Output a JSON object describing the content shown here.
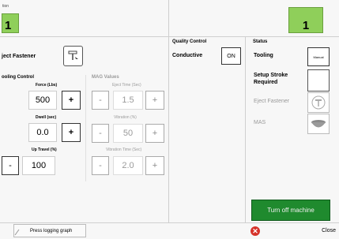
{
  "top": {
    "left_small_label": "tion",
    "left_counter": "1",
    "right_counter": "1"
  },
  "left": {
    "eject_label": "ject Fastener",
    "tooling_control_title": "ooling Control",
    "force_label": "Force (Lbs)",
    "force_value": "500",
    "dwell_label": "Dwell (sec)",
    "dwell_value": "0.0",
    "uptravel_label": "Up Travel (%)",
    "uptravel_value": "100",
    "plus": "+",
    "minus": "-"
  },
  "mag": {
    "title": "MAG Values",
    "eject_time_label": "Eject Time (Sec)",
    "eject_time_value": "1.5",
    "vibration_label": "Vibration (%)",
    "vibration_value": "50",
    "vibration_time_label": "Vibration Time (Sec)",
    "vibration_time_value": "2.0",
    "plus": "+",
    "minus": "-"
  },
  "quality": {
    "title": "Quality Control",
    "conductive_label": "Conductive",
    "conductive_state": "ON"
  },
  "status": {
    "title": "Status",
    "tooling_label": "Tooling",
    "tooling_button": "Manual",
    "setup_stroke_label_1": "Setup Stroke",
    "setup_stroke_label_2": "Required",
    "eject_fastener_label": "Eject Fastener",
    "mas_label": "MAS",
    "turn_off_label": "Turn off machine"
  },
  "bottom": {
    "press_logging_label": "Press logging graph",
    "close_label": "Close"
  },
  "colors": {
    "green": "#8fcf5a",
    "turn_off_green": "#1f8a2e",
    "close_red": "#d6332a"
  }
}
